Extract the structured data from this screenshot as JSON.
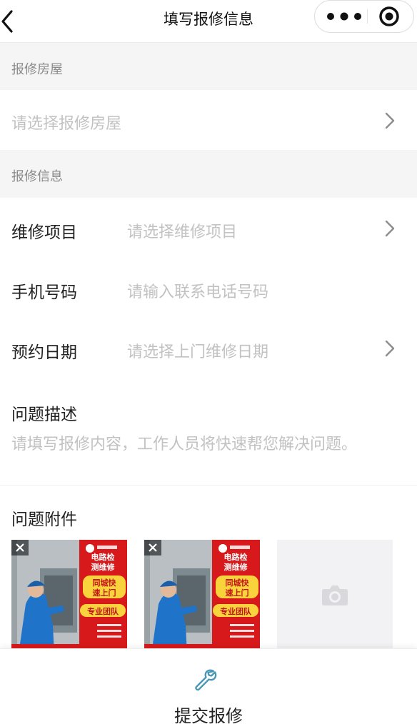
{
  "nav": {
    "title": "填写报修信息",
    "back_icon": "chevron-left-icon",
    "more_icon": "more-dots-icon",
    "close_icon": "target-circle-icon"
  },
  "sections": {
    "house_header": "报修房屋",
    "info_header": "报修信息"
  },
  "house": {
    "placeholder": "请选择报修房屋"
  },
  "form": {
    "item": {
      "label": "维修项目",
      "placeholder": "请选择维修项目"
    },
    "phone": {
      "label": "手机号码",
      "placeholder": "请输入联系电话号码"
    },
    "date": {
      "label": "预约日期",
      "placeholder": "请选择上门维修日期"
    },
    "description": {
      "label": "问题描述",
      "placeholder": "请填写报修内容，工作人员将快速帮您解决问题。"
    }
  },
  "attachments": {
    "label": "问题附件",
    "images": [
      {
        "line1": "电路检",
        "line2": "测维修",
        "badge1": "同城快",
        "badge2": "速上门",
        "badge3": "专业团队"
      },
      {
        "line1": "电路检",
        "line2": "测维修",
        "badge1": "同城快",
        "badge2": "速上门",
        "badge3": "专业团队"
      }
    ],
    "add_icon": "camera-icon",
    "delete_icon": "close-icon"
  },
  "footer": {
    "submit_label": "提交报修",
    "submit_icon": "wrench-icon"
  },
  "colors": {
    "accent_teal": "#4a97b3",
    "section_bg": "#f5f5f5",
    "placeholder": "#c2c2c2",
    "ad_red": "#d8191c",
    "ad_yellow": "#f8d33b"
  }
}
